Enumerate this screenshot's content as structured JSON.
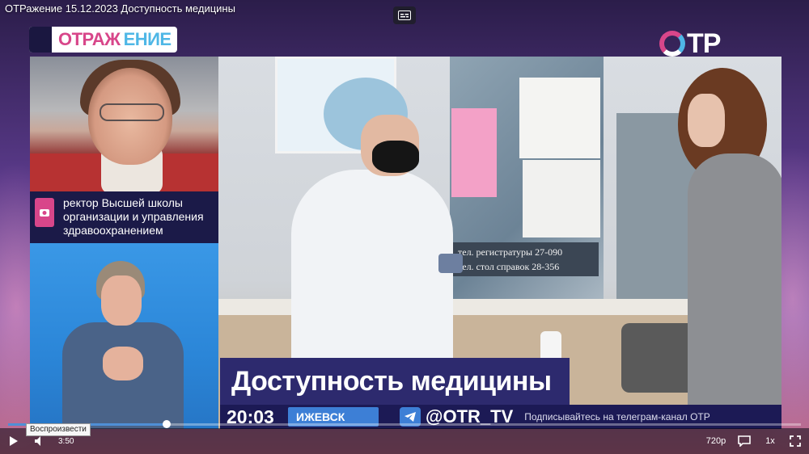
{
  "window": {
    "title": "ОТРажение 15.12.2023 Доступность медицины"
  },
  "logos": {
    "program_a": "ОТРАЖ",
    "program_b": "ЕНИЕ",
    "channel": "ТР"
  },
  "guest": {
    "caption": "ректор Высшей школы организации и управления здравоохранением"
  },
  "main_video": {
    "sign_line1": "тел. регистратуры  27-090",
    "sign_line2": "тел. стол справок  28-356"
  },
  "lower_third": {
    "title": "Доступность медицины",
    "time": "20:03",
    "city": "ИЖЕВСК",
    "telegram_handle": "@OTR_TV",
    "telegram_text": "Подписывайтесь на телеграм-канал ОТР"
  },
  "player": {
    "progress": 0.2,
    "time": "3:50",
    "quality": "720p",
    "speed": "1x",
    "tooltip": "Воспроизвести"
  },
  "colors": {
    "accent_pink": "#d8468a",
    "accent_blue": "#4fb7e6",
    "banner_navy": "#2d2a6e",
    "progress_blue": "#4f8fd6"
  },
  "icons": [
    "captions-icon",
    "play-icon",
    "volume-icon",
    "cc-icon",
    "fullscreen-icon",
    "telegram-icon",
    "camera-icon"
  ]
}
